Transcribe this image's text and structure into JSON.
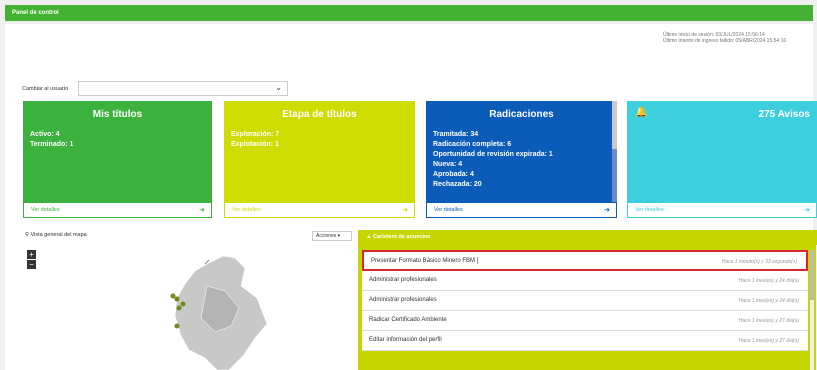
{
  "header": {
    "title": "Panel de control"
  },
  "session": {
    "last_login": "Último inicio de sesión: 03/JUL/2024 15:56:14",
    "last_failed": "Último intento de ingreso fallido: 05/ABR/2024 15:54:16"
  },
  "user_switch": {
    "label": "Cambiar al usuario",
    "value": ""
  },
  "cards": [
    {
      "title": "Mis títulos",
      "lines": [
        "Activo: 4",
        "Terminado: 1"
      ],
      "footer": "Ver detalles"
    },
    {
      "title": "Etapa de títulos",
      "lines": [
        "Exploración: 7",
        "Explotación: 1"
      ],
      "footer": "Ver detalles"
    },
    {
      "title": "Radicaciones",
      "lines": [
        "Tramitada: 34",
        "Radicación completa: 6",
        "Oportunidad de revisión expirada: 1",
        "Nueva: 4",
        "Aprobada: 4",
        "Rechazada: 20"
      ],
      "footer": "Ver detalles"
    },
    {
      "title": "275 Avisos",
      "lines": [],
      "footer": "Ver detalles"
    }
  ],
  "map": {
    "title": "Vista general del mapa",
    "actions": "Acciones ▾",
    "zoom_in": "+",
    "zoom_out": "−"
  },
  "feed": {
    "title": "Cartelera de anuncios",
    "items": [
      {
        "text": "Presentar Formato Básico Minero FBM [",
        "ago": "Hace 1 minuto(s) y 33 segundo(s)",
        "highlighted": true
      },
      {
        "text": "Administrar profesionales",
        "ago": "Hace 1 mes(es) y 24 día(s)",
        "highlighted": false
      },
      {
        "text": "Administrar profesionales",
        "ago": "Hace 1 mes(es) y 24 día(s)",
        "highlighted": false
      },
      {
        "text": "Radicar Certificado Ambiente",
        "ago": "Hace 1 mes(es) y 27 día(s)",
        "highlighted": false
      },
      {
        "text": "Editar información del perfil",
        "ago": "Hace 1 mes(es) y 27 día(s)",
        "highlighted": false
      }
    ]
  },
  "colors": {
    "green": "#3db13d",
    "lime": "#cfdc00",
    "blue": "#0a5cb8",
    "cyan": "#3ecfdf",
    "alert_red": "#d8262f"
  },
  "icons": {
    "bell": "bell-icon",
    "pin": "map-pin-icon",
    "arrow": "circle-arrow-right-icon"
  }
}
